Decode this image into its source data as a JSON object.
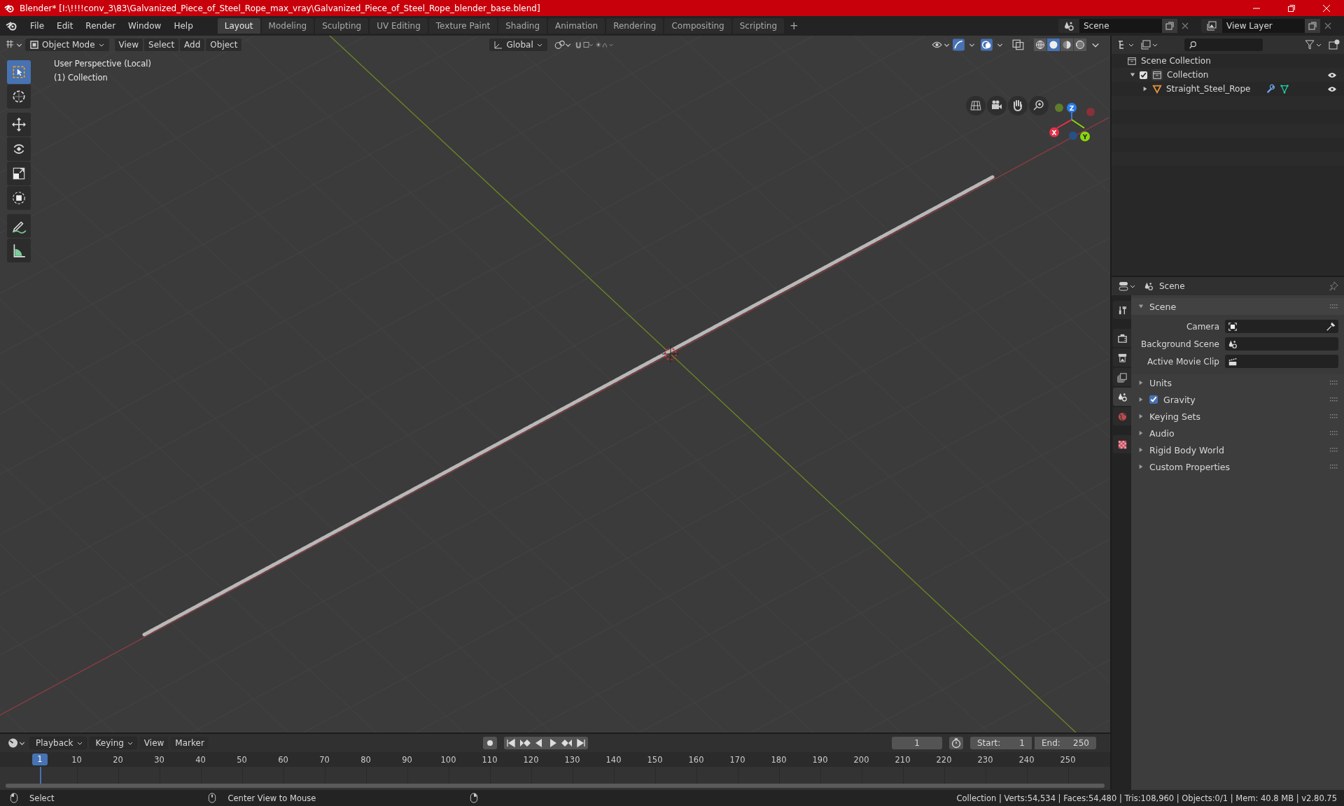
{
  "window": {
    "title": "Blender* [I:\\!!!!conv_3\\83\\Galvanized_Piece_of_Steel_Rope_max_vray\\Galvanized_Piece_of_Steel_Rope_blender_base.blend]"
  },
  "menu": [
    "File",
    "Edit",
    "Render",
    "Window",
    "Help"
  ],
  "workspaces": [
    {
      "label": "Layout",
      "selected": true
    },
    {
      "label": "Modeling",
      "selected": false
    },
    {
      "label": "Sculpting",
      "selected": false
    },
    {
      "label": "UV Editing",
      "selected": false
    },
    {
      "label": "Texture Paint",
      "selected": false
    },
    {
      "label": "Shading",
      "selected": false
    },
    {
      "label": "Animation",
      "selected": false
    },
    {
      "label": "Rendering",
      "selected": false
    },
    {
      "label": "Compositing",
      "selected": false
    },
    {
      "label": "Scripting",
      "selected": false
    }
  ],
  "add_workspace": "+",
  "scene": {
    "value": "Scene"
  },
  "view_layer": {
    "value": "View Layer"
  },
  "viewport": {
    "mode": "Object Mode",
    "menus": [
      "View",
      "Select",
      "Add",
      "Object"
    ],
    "orientation": "Global",
    "info": [
      "User Perspective (Local)",
      "(1) Collection"
    ],
    "tools": [
      {
        "kind": "select",
        "selected": true
      },
      {
        "kind": "cursor",
        "selected": false
      },
      {
        "kind": "move",
        "selected": false
      },
      {
        "kind": "rotate",
        "selected": false
      },
      {
        "kind": "scale",
        "selected": false
      },
      {
        "kind": "transform",
        "selected": false
      },
      {
        "kind": "annotate",
        "selected": false
      },
      {
        "kind": "measure",
        "selected": false
      }
    ],
    "shading": [
      {
        "kind": "wireframe",
        "selected": false
      },
      {
        "kind": "solid",
        "selected": true
      },
      {
        "kind": "material",
        "selected": false
      },
      {
        "kind": "rendered",
        "selected": false
      }
    ],
    "gizmo": {
      "x": "X",
      "y": "Y",
      "z": "Z"
    }
  },
  "outliner": {
    "tree": [
      {
        "label": "Scene Collection",
        "children": [
          {
            "label": "Collection",
            "checked": true,
            "expanded": true,
            "children": [
              {
                "label": "Straight_Steel_Rope",
                "expanded": false
              }
            ]
          }
        ]
      }
    ]
  },
  "properties": {
    "title": "Scene",
    "tabs": [
      {
        "kind": "tool",
        "selected": false
      },
      {
        "kind": "render",
        "selected": false
      },
      {
        "kind": "output",
        "selected": false
      },
      {
        "kind": "view-layer",
        "selected": false
      },
      {
        "kind": "scene",
        "selected": true
      },
      {
        "kind": "world",
        "selected": false
      },
      {
        "kind": "texture",
        "selected": false
      }
    ],
    "panels": [
      {
        "label": "Scene",
        "expanded": true,
        "fields": [
          {
            "label": "Camera",
            "kind": "camera"
          },
          {
            "label": "Background Scene",
            "kind": "scene"
          },
          {
            "label": "Active Movie Clip",
            "kind": "clip"
          }
        ]
      },
      {
        "label": "Units",
        "expanded": false
      },
      {
        "label": "Gravity",
        "expanded": false,
        "checked": true
      },
      {
        "label": "Keying Sets",
        "expanded": false
      },
      {
        "label": "Audio",
        "expanded": false
      },
      {
        "label": "Rigid Body World",
        "expanded": false
      },
      {
        "label": "Custom Properties",
        "expanded": false
      }
    ]
  },
  "timeline": {
    "dropdowns": [
      "Playback",
      "Keying"
    ],
    "menus": [
      "View",
      "Marker"
    ],
    "current_frame": "1",
    "start": {
      "label": "Start:",
      "value": "1"
    },
    "end": {
      "label": "End:",
      "value": "250"
    },
    "playhead": "1",
    "ruler": [
      "10",
      "20",
      "30",
      "40",
      "50",
      "60",
      "70",
      "80",
      "90",
      "100",
      "110",
      "120",
      "130",
      "140",
      "150",
      "160",
      "170",
      "180",
      "190",
      "200",
      "210",
      "220",
      "230",
      "240",
      "250"
    ]
  },
  "status_bar": {
    "hints": [
      {
        "kind": "mouse-left",
        "label": "Select"
      },
      {
        "kind": "mouse-middle",
        "label": "Center View to Mouse"
      },
      {
        "kind": "mouse-right"
      }
    ],
    "stats": "Collection | Verts:54,534 | Faces:54,480 | Tris:108,960 | Objects:0/1 | Mem: 40.8 MB | v2.80.75"
  }
}
